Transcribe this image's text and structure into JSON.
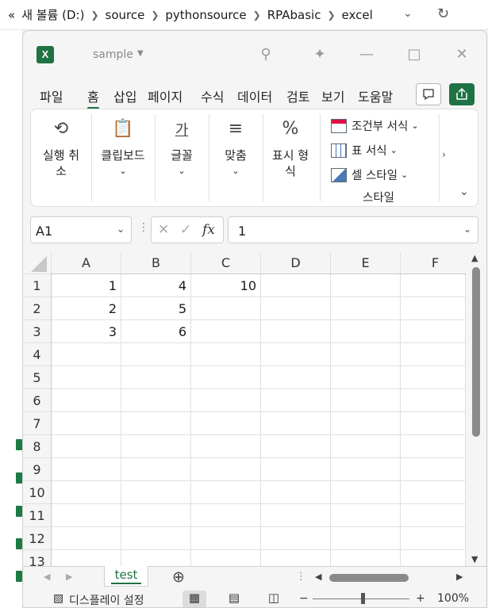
{
  "explorer": {
    "path": [
      "«",
      "새 볼륨 (D:)",
      "source",
      "pythonsource",
      "RPAbasic",
      "excel"
    ]
  },
  "window": {
    "doc_title": "sample"
  },
  "tabs": [
    "파일",
    "홈",
    "삽입",
    "페이지",
    "수식",
    "데이터",
    "검토",
    "보기",
    "도움말"
  ],
  "active_tab": "홈",
  "ribbon": {
    "undo": "실행 취\n소",
    "clipboard": "클립보드",
    "font": "글꼴",
    "font_icon": "가",
    "align": "맞춤",
    "number": "표시 형\n식",
    "number_icon": "%",
    "styles": {
      "conditional": "조건부 서식",
      "format_table": "표 서식",
      "cell_styles": "셀 스타일",
      "group_label": "스타일"
    }
  },
  "formula_bar": {
    "name_box": "A1",
    "fx": "fx",
    "value": "1"
  },
  "grid": {
    "columns": [
      "A",
      "B",
      "C",
      "D",
      "E",
      "F"
    ],
    "rows": [
      "1",
      "2",
      "3",
      "4",
      "5",
      "6",
      "7",
      "8",
      "9",
      "10",
      "11",
      "12",
      "13"
    ],
    "cells": [
      [
        "1",
        "4",
        "10",
        "",
        "",
        ""
      ],
      [
        "2",
        "5",
        "",
        "",
        "",
        ""
      ],
      [
        "3",
        "6",
        "",
        "",
        "",
        ""
      ]
    ]
  },
  "sheets": [
    "test"
  ],
  "status": {
    "display_settings": "디스플레이 설정",
    "zoom": "100%",
    "zoom_value_percent": 100
  }
}
